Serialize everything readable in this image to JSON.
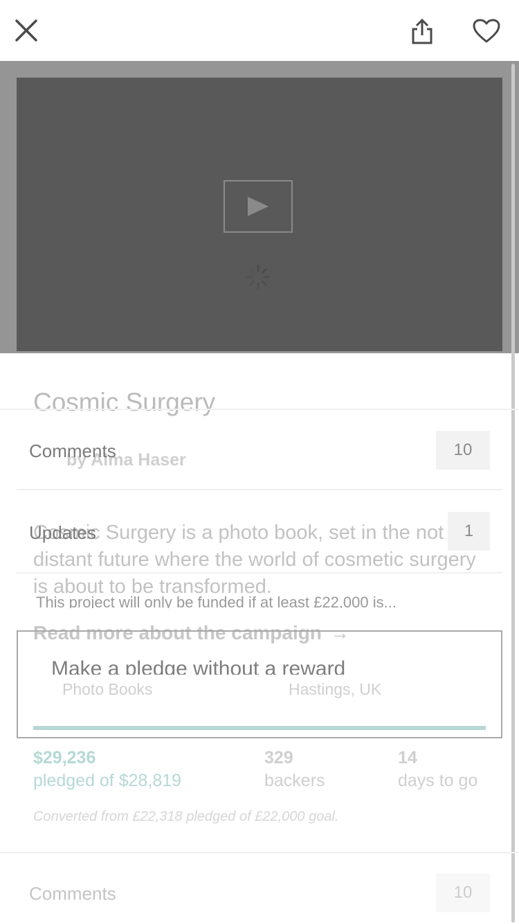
{
  "project": {
    "title": "Cosmic Surgery",
    "byline": "by Alma Haser",
    "blurb": "Cosmic Surgery is a photo book, set in the not too distant future where the world of cosmetic surgery is about to be transformed.",
    "funding_note": "This project will only be funded if at least £22,000 is...",
    "read_more_label": "Read more about the campaign",
    "read_more_arrow": "→",
    "pledge_label": "Make a pledge without a reward",
    "category": "Photo Books",
    "location": "Hastings, UK"
  },
  "stats": {
    "progress_fraction": 1.0,
    "pledged_amount": "$29,236",
    "pledged_of": "pledged of $28,819",
    "backers_count": "329",
    "backers_label": "backers",
    "days_count": "14",
    "days_label": "days to go",
    "converted_note": "Converted from £22,318 pledged of £22,000 goal."
  },
  "rows": {
    "comments_label": "Comments",
    "comments_count": "10",
    "updates_label": "Updates",
    "updates_count": "1",
    "comments_label_2": "Comments",
    "comments_count_2": "10"
  },
  "icons": {
    "close": "close-icon",
    "share": "share-icon",
    "favorite": "heart-icon",
    "play": "play-icon",
    "loading": "spinner-icon"
  },
  "colors": {
    "accent": "#b8d8d6",
    "video_bg": "#595959",
    "overlay_bg": "#959595"
  }
}
